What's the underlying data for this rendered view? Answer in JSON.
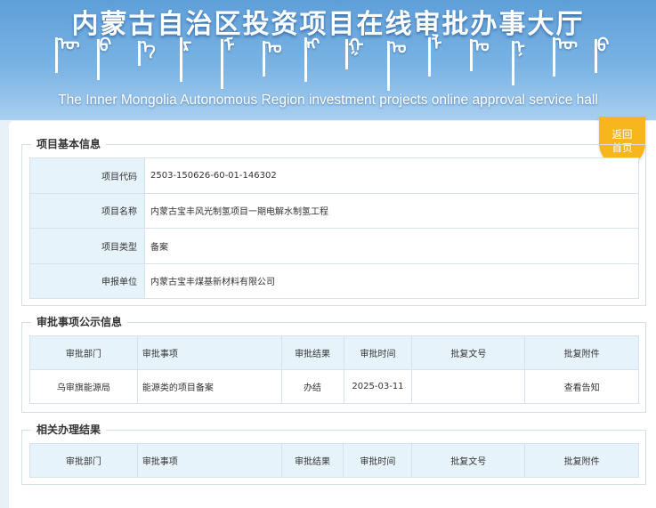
{
  "header": {
    "title": "内蒙古自治区投资项目在线审批办事大厅",
    "mongolian_glyphs": [
      "ᠥ",
      "ᠪ",
      "ᠡ",
      "ᠷ",
      "ᠮ",
      "ᠣ",
      "ᠩ",
      "ᠭ",
      "ᠣ",
      "ᠯ",
      "ᠤ",
      "ᠨ",
      "ᠥ",
      "ᠪ"
    ],
    "subtitle": "The Inner Mongolia Autonomous Region investment projects online approval service hall"
  },
  "home_button": {
    "line1": "返回",
    "line2": "首页"
  },
  "basic_info": {
    "legend": "项目基本信息",
    "rows": [
      {
        "label": "项目代码",
        "value": "2503-150626-60-01-146302"
      },
      {
        "label": "项目名称",
        "value": "内蒙古宝丰风光制氢项目一期电解水制氢工程"
      },
      {
        "label": "项目类型",
        "value": "备案"
      },
      {
        "label": "申报单位",
        "value": "内蒙古宝丰煤基新材料有限公司"
      }
    ]
  },
  "approval_public": {
    "legend": "审批事项公示信息",
    "headers": [
      "审批部门",
      "审批事项",
      "审批结果",
      "审批时间",
      "批复文号",
      "批复附件"
    ],
    "rows": [
      [
        "乌审旗能源局",
        "能源类的项目备案",
        "办结",
        "2025-03-11",
        "",
        "查看告知"
      ]
    ]
  },
  "related_results": {
    "legend": "相关办理结果",
    "headers": [
      "审批部门",
      "审批事项",
      "审批结果",
      "审批时间",
      "批复文号",
      "批复附件"
    ]
  }
}
